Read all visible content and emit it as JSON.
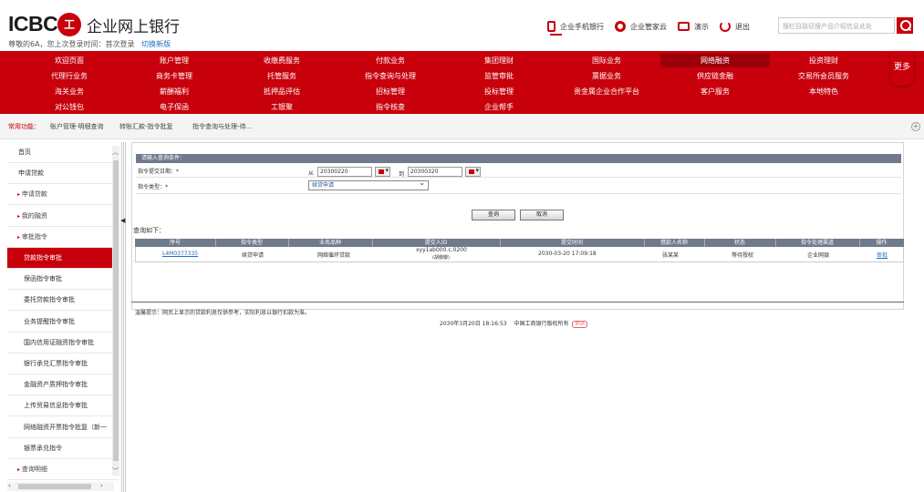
{
  "header": {
    "logo_text": "ICBC",
    "logo_mark": "工",
    "bank_name": "企业网上银行",
    "welcome": "尊敬的6A，您上次登录时间：首次登录",
    "switch_link": "切换新版",
    "tools": [
      {
        "label": "企业手机银行",
        "icon": "mobile-icon"
      },
      {
        "label": "企业管家云",
        "icon": "cloud-icon"
      },
      {
        "label": "演示",
        "icon": "demo-icon"
      },
      {
        "label": "退出",
        "icon": "power-icon"
      }
    ],
    "search_placeholder": "搜栏目路径搜产品介绍信息此处",
    "brand_color": "#c7000b"
  },
  "menu": {
    "rows": [
      [
        "欢迎页面",
        "账户管理",
        "收缴费服务",
        "付款业务",
        "集团理财",
        "国际业务",
        "网络融资",
        "投资理财"
      ],
      [
        "代理行业务",
        "商务卡管理",
        "托管服务",
        "指令查询与处理",
        "监管审批",
        "票据业务",
        "供应链金融",
        "交易所会员服务"
      ],
      [
        "海关业务",
        "薪酬福利",
        "抵押品评估",
        "招标管理",
        "投标管理",
        "贵金属企业合作平台",
        "客户服务",
        "本地特色"
      ],
      [
        "对公钱包",
        "电子保函",
        "工银聚",
        "指令核查",
        "企业帮手"
      ]
    ],
    "highlighted": "网络融资",
    "more_label": "更多"
  },
  "quick": {
    "label": "常用功能：",
    "links": [
      "账户管理-明细查询",
      "转账汇款-指令批复",
      "指令查询与处理-待..."
    ]
  },
  "sidebar": {
    "items": [
      {
        "label": "首页",
        "type": "top"
      },
      {
        "label": "申请贷款",
        "type": "top"
      },
      {
        "label": "申请贷款",
        "type": "group"
      },
      {
        "label": "我的融资",
        "type": "group"
      },
      {
        "label": "审批指令",
        "type": "group-open"
      },
      {
        "label": "贷款指令审批",
        "type": "sub",
        "active": true
      },
      {
        "label": "保函指令审批",
        "type": "sub"
      },
      {
        "label": "委托贷款指令审批",
        "type": "sub"
      },
      {
        "label": "业务提醒指令审批",
        "type": "sub"
      },
      {
        "label": "国内信用证融资指令审批",
        "type": "sub"
      },
      {
        "label": "银行承兑汇票指令审批",
        "type": "sub"
      },
      {
        "label": "金融资产质押指令审批",
        "type": "sub"
      },
      {
        "label": "上传贸易信息指令审批",
        "type": "sub"
      },
      {
        "label": "网络融资开票指令批复（新一",
        "type": "sub"
      },
      {
        "label": "银票承兑指令",
        "type": "sub"
      },
      {
        "label": "查询明细",
        "type": "group"
      }
    ]
  },
  "query": {
    "title": "请输入查询条件：",
    "date_label": "指令提交日期：*",
    "from_label": "从",
    "from_value": "20300220",
    "to_label": "到",
    "to_value": "20300320",
    "type_label": "指令类型：*",
    "type_value": "续贷申请",
    "query_button": "查询",
    "cancel_button": "取消"
  },
  "results": {
    "label": "查询如下：",
    "columns": [
      "序号",
      "指令类型",
      "业务品种",
      "提交人ID",
      "提交时间",
      "借款人名称",
      "状态",
      "指令处理渠道",
      "操作"
    ],
    "rows": [
      {
        "seq": "L4M0377335",
        "type": "续贷申请",
        "product": "网络循环贷款",
        "submitter": "xyy1ab000.c.0200",
        "submitter_sub": "(胡瓣瓣)",
        "time": "2030-03-20 17:09:18",
        "borrower": "张某某",
        "status": "等待授权",
        "channel": "企业网银",
        "action": "审批"
      }
    ]
  },
  "hint": "温馨提示：网页上显示的贷款利息仅供参考，实际利息以银行扣款为准。",
  "footer": {
    "text": "2030年3月20日 18:16:53　 中国工商银行版权所有",
    "badge": "IPv6"
  }
}
